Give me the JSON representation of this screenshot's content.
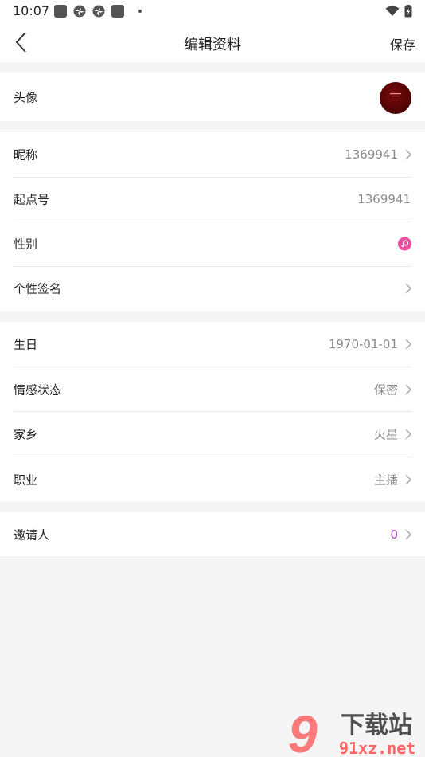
{
  "status": {
    "time": "10:07"
  },
  "header": {
    "title": "编辑资料",
    "save_label": "保存"
  },
  "sections": {
    "avatar": {
      "label": "头像"
    },
    "basic": {
      "nickname": {
        "label": "昵称",
        "value": "1369941"
      },
      "qidian_id": {
        "label": "起点号",
        "value": "1369941"
      },
      "gender": {
        "label": "性别"
      },
      "signature": {
        "label": "个性签名"
      }
    },
    "detail": {
      "birthday": {
        "label": "生日",
        "value": "1970-01-01"
      },
      "relationship": {
        "label": "情感状态",
        "value": "保密"
      },
      "hometown": {
        "label": "家乡",
        "value": "火星"
      },
      "occupation": {
        "label": "职业",
        "value": "主播"
      }
    },
    "invite": {
      "label": "邀请人",
      "value": "0"
    }
  },
  "watermark": {
    "number": "9",
    "text": "下载站",
    "url": "91xz.net"
  },
  "colors": {
    "accent_purple": "#9b37c9",
    "gender_pink": "#ee4ea0",
    "avatar_dark_red": "#5a0505"
  }
}
